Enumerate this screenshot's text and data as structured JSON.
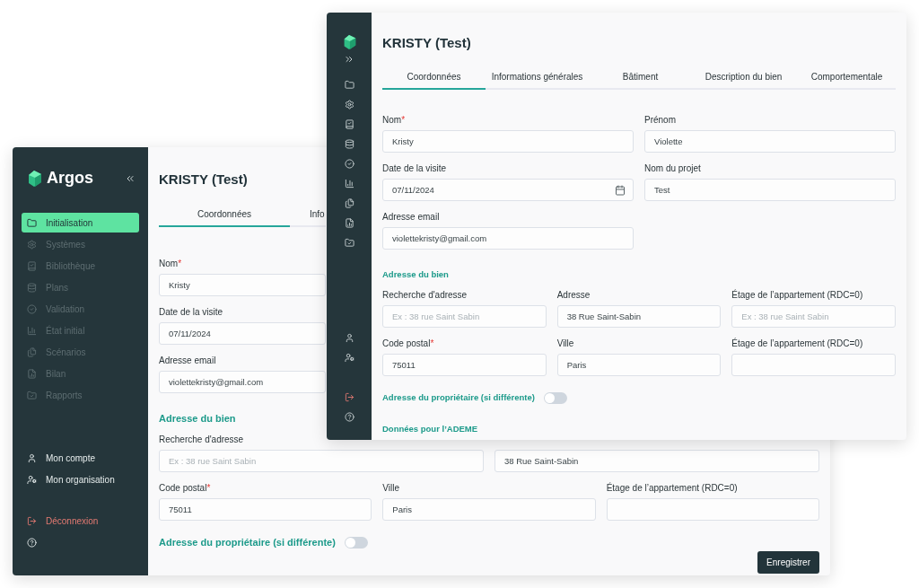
{
  "back_window": {
    "brand": "Argos",
    "sidebar": {
      "items": [
        {
          "label": "Initialisation",
          "selected": true,
          "disabled": false
        },
        {
          "label": "Systèmes",
          "selected": false,
          "disabled": true
        },
        {
          "label": "Bibliothèque",
          "selected": false,
          "disabled": true
        },
        {
          "label": "Plans",
          "selected": false,
          "disabled": true
        },
        {
          "label": "Validation",
          "selected": false,
          "disabled": true
        },
        {
          "label": "État initial",
          "selected": false,
          "disabled": true
        },
        {
          "label": "Scénarios",
          "selected": false,
          "disabled": true
        },
        {
          "label": "Bilan",
          "selected": false,
          "disabled": true
        },
        {
          "label": "Rapports",
          "selected": false,
          "disabled": true
        }
      ],
      "account_items": [
        "Mon compte",
        "Mon organisation"
      ],
      "logout": "Déconnexion"
    },
    "title": "KRISTY (Test)",
    "tabs": [
      {
        "label": "Coordonnées",
        "selected": true
      },
      {
        "label": "Info",
        "selected": false
      }
    ],
    "form": [
      {
        "kind": "row",
        "fields": [
          {
            "label": "Nom",
            "required_mark": "*",
            "value": "Kristy"
          }
        ]
      },
      {
        "kind": "row",
        "fields": [
          {
            "label": "Date de la visite",
            "value": "07/11/2024"
          }
        ]
      },
      {
        "kind": "row",
        "fields": [
          {
            "label": "Adresse email",
            "value": "violettekristy@gmail.com"
          }
        ]
      },
      {
        "kind": "heading",
        "text": "Adresse du bien"
      },
      {
        "kind": "row",
        "fields": [
          {
            "label": "Recherche d'adresse",
            "placeholder": "Ex : 38 rue Saint Sabin"
          },
          {
            "value": "38 Rue Saint-Sabin"
          }
        ]
      },
      {
        "kind": "row",
        "fields": [
          {
            "label": "Code postal",
            "required_mark": "*",
            "value": "75011"
          },
          {
            "label": "Ville",
            "value": "Paris"
          },
          {
            "label": "Étage de l’appartement (RDC=0)"
          }
        ]
      },
      {
        "kind": "toggle",
        "label": "Adresse du propriétaire (si différente)",
        "on": false
      }
    ],
    "save_button": "Enregistrer"
  },
  "front_window": {
    "title": "KRISTY (Test)",
    "tabs": [
      {
        "label": "Coordonnées",
        "selected": true
      },
      {
        "label": "Informations générales",
        "selected": false
      },
      {
        "label": "Bâtiment",
        "selected": false
      },
      {
        "label": "Description du bien",
        "selected": false
      },
      {
        "label": "Comportementale",
        "selected": false
      }
    ],
    "form": [
      {
        "kind": "row",
        "fields": [
          {
            "label": "Nom",
            "required_mark": "*",
            "value": "Kristy"
          },
          {
            "label": "Prénom",
            "value": "Violette"
          }
        ]
      },
      {
        "kind": "row",
        "fields": [
          {
            "label": "Date de la visite",
            "value": "07/11/2024",
            "kind": "date"
          },
          {
            "label": "Nom du projet",
            "value": "Test"
          }
        ]
      },
      {
        "kind": "row",
        "fields": [
          {
            "label": "Adresse email",
            "value": "violettekristy@gmail.com"
          }
        ]
      },
      {
        "kind": "heading",
        "text": "Adresse du bien"
      },
      {
        "kind": "row",
        "fields": [
          {
            "label": "Recherche d'adresse",
            "placeholder": "Ex : 38 rue Saint Sabin"
          },
          {
            "label": "Adresse",
            "value": "38 Rue Saint-Sabin"
          },
          {
            "label": "Étage de l’appartement (RDC=0)",
            "placeholder": "Ex : 38 rue Saint Sabin"
          }
        ]
      },
      {
        "kind": "row",
        "fields": [
          {
            "label": "Code postal",
            "required_mark": "*",
            "value": "75011"
          },
          {
            "label": "Ville",
            "value": "Paris"
          },
          {
            "label": "Étage de l’appartement (RDC=0)"
          }
        ]
      },
      {
        "kind": "toggle",
        "label": "Adresse du propriétaire (si différente)",
        "on": false
      },
      {
        "kind": "heading",
        "text": "Données pour l’ADEME"
      }
    ]
  }
}
